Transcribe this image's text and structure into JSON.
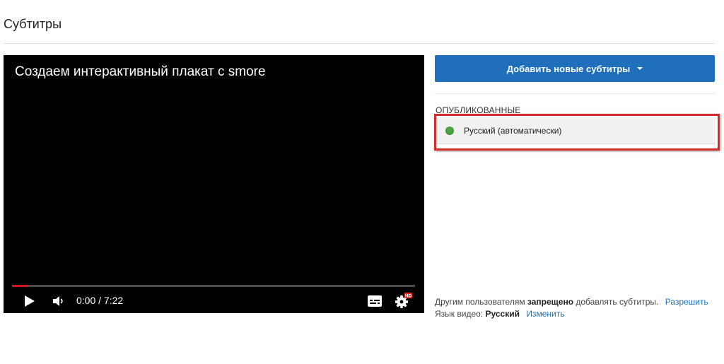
{
  "page": {
    "title": "Субтитры"
  },
  "player": {
    "video_title": "Создаем интерактивный плакат с smore",
    "time": "0:00 / 7:22",
    "progress_fraction": 0.04,
    "hd_badge": "HD"
  },
  "panel": {
    "add_button_label": "Добавить новые субтитры",
    "published_label": "ОПУБЛИКОВАННЫЕ",
    "tracks": [
      {
        "label": "Русский (автоматически)",
        "status_color": "#4aa542"
      }
    ],
    "permission": {
      "prefix": "Другим пользователям",
      "bold": "запрещено",
      "suffix": "добавлять субтитры.",
      "link": "Разрешить"
    },
    "language": {
      "prefix": "Язык видео:",
      "value": "Русский",
      "link": "Изменить"
    }
  },
  "colors": {
    "accent": "#1f6fba",
    "highlight": "#d62b2b",
    "link": "#1a73c2"
  },
  "icons": [
    "play-icon",
    "volume-icon",
    "subtitles-icon",
    "gear-icon",
    "caret-down-icon"
  ]
}
